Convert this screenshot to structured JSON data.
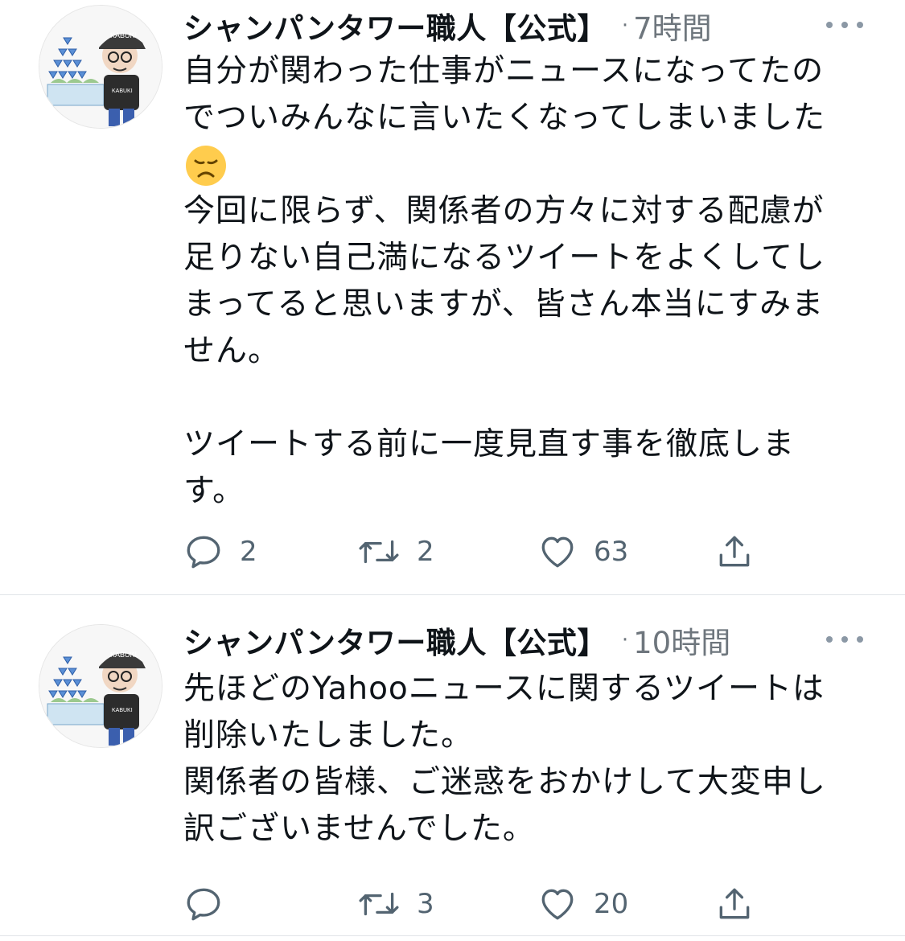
{
  "tweets": [
    {
      "author": "シャンパンタワー職人【公式】",
      "time": "7時間",
      "text_before_emoji": "自分が関わった仕事がニュースになってたの\nでついみんなに言いたくなってしまいました",
      "emoji": "disappointed-face",
      "text_after_emoji": "今回に限らず、関係者の方々に対する配慮が\n足りない自己満になるツイートをよくしてし\nまってると思いますが、皆さん本当にすみま\nせん。\n\nツイートする前に一度見直す事を徹底しま\nす。",
      "replies": "2",
      "retweets": "2",
      "likes": "63"
    },
    {
      "author": "シャンパンタワー職人【公式】",
      "time": "10時間",
      "text": "先ほどのYahooニュースに関するツイートは\n削除いたしました。\n関係者の皆様、ご迷惑をおかけして大変申し\n訳ございませんでした。",
      "replies": "",
      "retweets": "3",
      "likes": "20"
    }
  ],
  "avatar": {
    "cap_text": "KABUKI",
    "shirt_text": "KABUKI"
  },
  "colors": {
    "text": "#0f1419",
    "muted": "#6e767d",
    "icon": "#536471",
    "divider": "#e1e4e8"
  }
}
